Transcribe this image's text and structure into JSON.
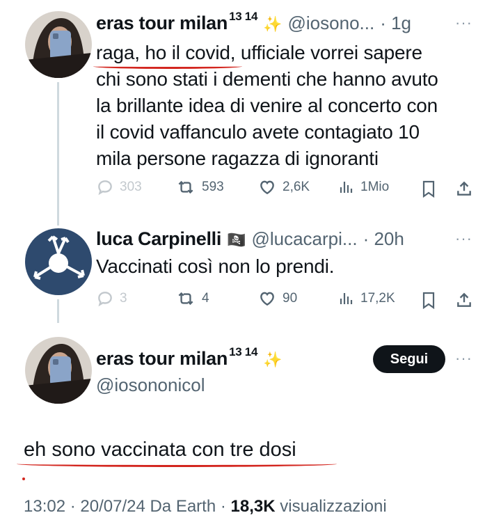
{
  "tweets": [
    {
      "name": "eras tour milan",
      "superscript": "13 14",
      "emoji": "✨",
      "handle": "@iosono...",
      "time": "· 1g",
      "more": "···",
      "lines": [
        "raga, ho il covid, ufficiale vorrei sapere",
        "chi sono stati i dementi che hanno avuto",
        "la brillante idea di venire al concerto con",
        "il covid vaffanculo avete contagiato 10",
        "mila persone ragazza di ignoranti"
      ],
      "replies": "303",
      "retweets": "593",
      "likes": "2,6K",
      "views": "1Mio"
    },
    {
      "name": "luca Carpinelli",
      "flag": "🏴‍☠️",
      "handle": "@lucacarpi...",
      "time": "· 20h",
      "more": "···",
      "text": "Vaccinati così non lo prendi.",
      "replies": "3",
      "retweets": "4",
      "likes": "90",
      "views": "17,2K"
    }
  ],
  "main": {
    "name": "eras tour milan",
    "superscript": "13 14",
    "emoji": "✨",
    "handle": "@iosononicol",
    "follow_label": "Segui",
    "more": "···",
    "text": "eh sono vaccinata con tre dosi",
    "footer_time": "13:02 · 20/07/24 Da Earth ·",
    "footer_views": "18,3K",
    "footer_views_label": "visualizzazioni"
  },
  "colors": {
    "underline": "#d3261f",
    "follow_bg": "#0f1419",
    "muted": "#536471"
  }
}
